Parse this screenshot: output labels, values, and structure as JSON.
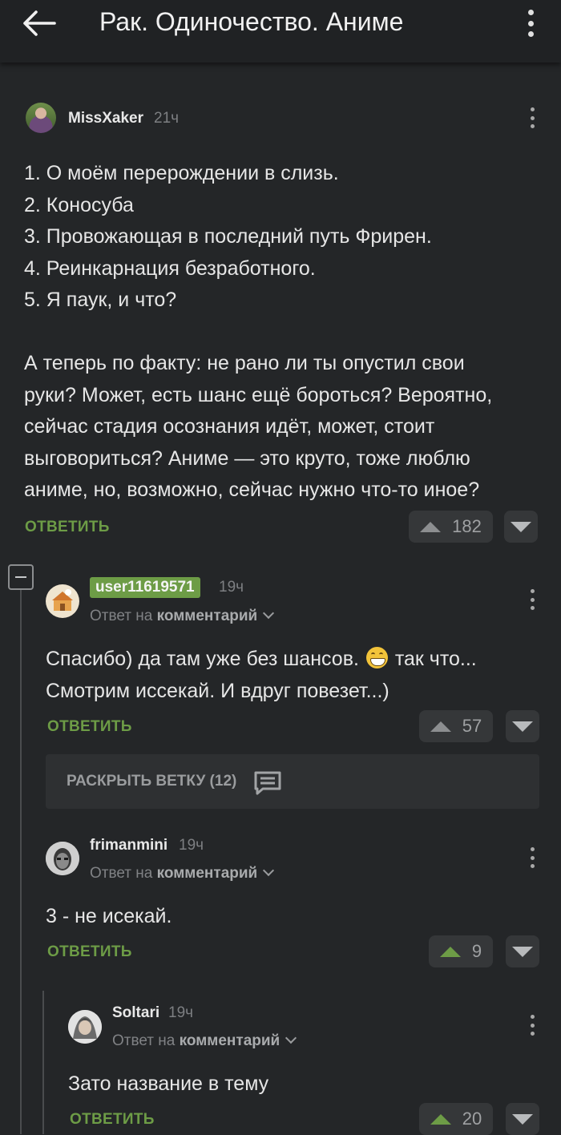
{
  "header": {
    "title": "Рак. Одиночество. Аниме"
  },
  "comments": [
    {
      "username": "MissXaker",
      "time": "21ч",
      "lines": [
        "1. О моём перерождении в слизь.",
        "2. Коносуба",
        "3. Провожающая в последний путь Фрирен.",
        "4. Реинкарнация безработного.",
        "5. Я паук, и что?",
        "",
        "А теперь по факту: не рано ли ты опустил свои",
        "руки? Может, есть шанс ещё бороться? Вероятно,",
        "сейчас стадия осознания идёт, может, стоит",
        "выговориться? Аниме — это круто, тоже люблю",
        "аниме, но, возможно, сейчас нужно что-то иное?"
      ],
      "reply_label": "ОТВЕТИТЬ",
      "votes": "182"
    },
    {
      "username": "user11619571",
      "time": "19ч",
      "reply_prefix": "Ответ на",
      "reply_target": "комментарий",
      "line1_start": "Спасибо) да там уже без шансов.",
      "line1_emoji": "grinning-face-emoji",
      "line1_end": "так что...",
      "line2": "Смотрим иссекай. И вдруг повезет...)",
      "reply_label": "ОТВЕТИТЬ",
      "votes": "57",
      "expand_label": "РАСКРЫТЬ ВЕТКУ (12)"
    },
    {
      "username": "frimanmini",
      "time": "19ч",
      "reply_prefix": "Ответ на",
      "reply_target": "комментарий",
      "text": "3 - не исекай.",
      "reply_label": "ОТВЕТИТЬ",
      "votes": "9"
    },
    {
      "username": "Soltari",
      "time": "19ч",
      "reply_prefix": "Ответ на",
      "reply_target": "комментарий",
      "text": "Зато название в тему",
      "reply_label": "ОТВЕТИТЬ",
      "votes": "20"
    }
  ],
  "colors": {
    "background": "#242628",
    "accent_green": "#6d9c46",
    "text": "#e6e6e6",
    "muted": "#7d7f82"
  },
  "icons": {
    "back": "back-arrow-icon",
    "menu": "more-vert-icon",
    "upvote": "triangle-up-icon",
    "downvote": "triangle-down-icon",
    "expand": "comment-bubble-icon",
    "collapse": "minus-square-icon"
  }
}
